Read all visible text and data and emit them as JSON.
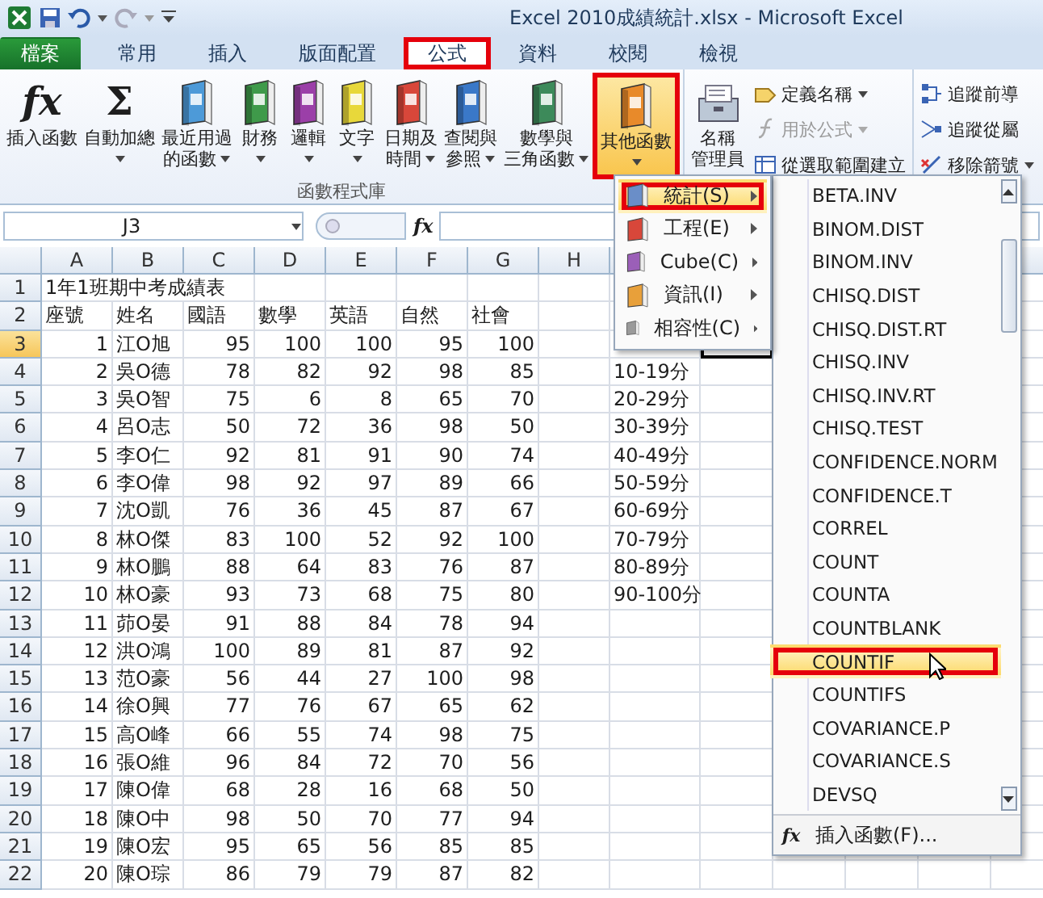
{
  "title_bar": {
    "title": "Excel 2010成績統計.xlsx - Microsoft Excel"
  },
  "ribbon_tabs": [
    {
      "label": "檔案",
      "kind": "file",
      "selected": false,
      "highlighted": false
    },
    {
      "label": "常用",
      "kind": "tab",
      "selected": false,
      "highlighted": false
    },
    {
      "label": "插入",
      "kind": "tab",
      "selected": false,
      "highlighted": false
    },
    {
      "label": "版面配置",
      "kind": "tab",
      "selected": false,
      "highlighted": false
    },
    {
      "label": "公式",
      "kind": "tab",
      "selected": true,
      "highlighted": true
    },
    {
      "label": "資料",
      "kind": "tab",
      "selected": false,
      "highlighted": false
    },
    {
      "label": "校閱",
      "kind": "tab",
      "selected": false,
      "highlighted": false
    },
    {
      "label": "檢視",
      "kind": "tab",
      "selected": false,
      "highlighted": false
    }
  ],
  "function_library": {
    "label": "函數程式庫",
    "buttons": [
      {
        "kind": "glyph",
        "glyph": "fx",
        "lines": [
          "插入函數"
        ],
        "dropdown": false,
        "open": false,
        "highlighted": false
      },
      {
        "kind": "glyph",
        "glyph": "Σ",
        "lines": [
          "自動加總"
        ],
        "dropdown": true,
        "open": false,
        "highlighted": false
      },
      {
        "kind": "book",
        "color": "#4d9ad8",
        "lines": [
          "最近用過",
          "的函數"
        ],
        "dropdown": true,
        "open": false,
        "highlighted": false
      },
      {
        "kind": "book",
        "color": "#3f9a4a",
        "lines": [
          "財務"
        ],
        "dropdown": true,
        "open": false,
        "highlighted": false
      },
      {
        "kind": "book",
        "color": "#9b3fa8",
        "lines": [
          "邏輯"
        ],
        "dropdown": true,
        "open": false,
        "highlighted": false
      },
      {
        "kind": "book",
        "color": "#e8d83a",
        "lines": [
          "文字"
        ],
        "dropdown": true,
        "open": false,
        "highlighted": false
      },
      {
        "kind": "book",
        "color": "#d8473a",
        "lines": [
          "日期及",
          "時間"
        ],
        "dropdown": true,
        "open": false,
        "highlighted": false
      },
      {
        "kind": "book",
        "color": "#3a78c8",
        "lines": [
          "查閱與",
          "參照"
        ],
        "dropdown": true,
        "open": false,
        "highlighted": false
      },
      {
        "kind": "book",
        "color": "#3d8a5a",
        "lines": [
          "數學與",
          "三角函數"
        ],
        "dropdown": true,
        "open": false,
        "highlighted": false
      },
      {
        "kind": "book",
        "color": "#e88a2a",
        "lines": [
          "其他函數"
        ],
        "dropdown": true,
        "open": true,
        "highlighted": true
      }
    ]
  },
  "defined_names": {
    "manager": {
      "lines": [
        "名稱",
        "管理員"
      ]
    },
    "commands": [
      {
        "label": "定義名稱",
        "dropdown": true,
        "disabled": false
      },
      {
        "label": "用於公式",
        "dropdown": true,
        "disabled": true
      },
      {
        "label": "從選取範圍建立",
        "dropdown": false,
        "disabled": false
      }
    ]
  },
  "formula_auditing": {
    "commands": [
      {
        "label": "追蹤前導",
        "dropdown": false
      },
      {
        "label": "追蹤從屬",
        "dropdown": false
      },
      {
        "label": "移除箭號",
        "dropdown": true
      }
    ]
  },
  "formula_bar": {
    "name_box": "J3",
    "fx": "fx"
  },
  "sheet": {
    "columns": [
      "A",
      "B",
      "C",
      "D",
      "E",
      "F",
      "G",
      "H"
    ],
    "rows": [
      {
        "header": "1",
        "kind": "title",
        "title": "1年1班期中考成績表",
        "active": false
      },
      {
        "header": "2",
        "kind": "header",
        "cells": [
          "座號",
          "姓名",
          "國語",
          "數學",
          "英語",
          "自然",
          "社會"
        ],
        "active": false
      },
      {
        "header": "3",
        "kind": "data",
        "cells": [
          "1",
          "江O旭",
          "95",
          "100",
          "100",
          "95",
          "100"
        ],
        "active": true
      },
      {
        "header": "4",
        "kind": "data",
        "cells": [
          "2",
          "吳O德",
          "78",
          "82",
          "92",
          "98",
          "85"
        ],
        "column_i": "10-19分",
        "active": false
      },
      {
        "header": "5",
        "kind": "data",
        "cells": [
          "3",
          "吳O智",
          "75",
          "6",
          "8",
          "65",
          "70"
        ],
        "column_i": "20-29分",
        "active": false
      },
      {
        "header": "6",
        "kind": "data",
        "cells": [
          "4",
          "呂O志",
          "50",
          "72",
          "36",
          "98",
          "50"
        ],
        "column_i": "30-39分",
        "active": false
      },
      {
        "header": "7",
        "kind": "data",
        "cells": [
          "5",
          "李O仁",
          "92",
          "81",
          "91",
          "90",
          "74"
        ],
        "column_i": "40-49分",
        "active": false
      },
      {
        "header": "8",
        "kind": "data",
        "cells": [
          "6",
          "李O偉",
          "98",
          "92",
          "97",
          "89",
          "66"
        ],
        "column_i": "50-59分",
        "active": false
      },
      {
        "header": "9",
        "kind": "data",
        "cells": [
          "7",
          "沈O凱",
          "76",
          "36",
          "45",
          "87",
          "67"
        ],
        "column_i": "60-69分",
        "active": false
      },
      {
        "header": "10",
        "kind": "data",
        "cells": [
          "8",
          "林O傑",
          "83",
          "100",
          "52",
          "92",
          "100"
        ],
        "column_i": "70-79分",
        "active": false
      },
      {
        "header": "11",
        "kind": "data",
        "cells": [
          "9",
          "林O鵬",
          "88",
          "64",
          "83",
          "76",
          "87"
        ],
        "column_i": "80-89分",
        "active": false
      },
      {
        "header": "12",
        "kind": "data",
        "cells": [
          "10",
          "林O豪",
          "93",
          "73",
          "68",
          "75",
          "80"
        ],
        "column_i": "90-100分",
        "active": false
      },
      {
        "header": "13",
        "kind": "data",
        "cells": [
          "11",
          "茆O晏",
          "91",
          "88",
          "84",
          "78",
          "94"
        ],
        "active": false
      },
      {
        "header": "14",
        "kind": "data",
        "cells": [
          "12",
          "洪O鴻",
          "100",
          "89",
          "81",
          "87",
          "92"
        ],
        "active": false
      },
      {
        "header": "15",
        "kind": "data",
        "cells": [
          "13",
          "范O豪",
          "56",
          "44",
          "27",
          "100",
          "98"
        ],
        "active": false
      },
      {
        "header": "16",
        "kind": "data",
        "cells": [
          "14",
          "徐O興",
          "77",
          "76",
          "67",
          "65",
          "62"
        ],
        "active": false
      },
      {
        "header": "17",
        "kind": "data",
        "cells": [
          "15",
          "高O峰",
          "66",
          "55",
          "74",
          "98",
          "75"
        ],
        "active": false
      },
      {
        "header": "18",
        "kind": "data",
        "cells": [
          "16",
          "張O維",
          "96",
          "84",
          "72",
          "70",
          "56"
        ],
        "active": false
      },
      {
        "header": "19",
        "kind": "data",
        "cells": [
          "17",
          "陳O偉",
          "68",
          "28",
          "16",
          "68",
          "50"
        ],
        "active": false
      },
      {
        "header": "20",
        "kind": "data",
        "cells": [
          "18",
          "陳O中",
          "98",
          "50",
          "70",
          "77",
          "94"
        ],
        "active": false
      },
      {
        "header": "21",
        "kind": "data",
        "cells": [
          "19",
          "陳O宏",
          "95",
          "65",
          "56",
          "85",
          "85"
        ],
        "active": false
      },
      {
        "header": "22",
        "kind": "data",
        "cells": [
          "20",
          "陳O琮",
          "86",
          "79",
          "79",
          "87",
          "82"
        ],
        "active": false
      }
    ]
  },
  "category_menu": [
    {
      "label": "統計(S)",
      "color": "#6a8ec8",
      "selected": true,
      "highlighted": true
    },
    {
      "label": "工程(E)",
      "color": "#d8473a",
      "selected": false,
      "highlighted": false
    },
    {
      "label": "Cube(C)",
      "color": "#9b5fb8",
      "selected": false,
      "highlighted": false
    },
    {
      "label": "資訊(I)",
      "color": "#e8a03a",
      "selected": false,
      "highlighted": false
    },
    {
      "label": "相容性(C)",
      "color": "#9a9a9a",
      "selected": false,
      "highlighted": false
    }
  ],
  "function_menu": {
    "items": [
      {
        "label": "BETA.INV",
        "selected": false,
        "highlighted": false
      },
      {
        "label": "BINOM.DIST",
        "selected": false,
        "highlighted": false
      },
      {
        "label": "BINOM.INV",
        "selected": false,
        "highlighted": false
      },
      {
        "label": "CHISQ.DIST",
        "selected": false,
        "highlighted": false
      },
      {
        "label": "CHISQ.DIST.RT",
        "selected": false,
        "highlighted": false
      },
      {
        "label": "CHISQ.INV",
        "selected": false,
        "highlighted": false
      },
      {
        "label": "CHISQ.INV.RT",
        "selected": false,
        "highlighted": false
      },
      {
        "label": "CHISQ.TEST",
        "selected": false,
        "highlighted": false
      },
      {
        "label": "CONFIDENCE.NORM",
        "selected": false,
        "highlighted": false
      },
      {
        "label": "CONFIDENCE.T",
        "selected": false,
        "highlighted": false
      },
      {
        "label": "CORREL",
        "selected": false,
        "highlighted": false
      },
      {
        "label": "COUNT",
        "selected": false,
        "highlighted": false
      },
      {
        "label": "COUNTA",
        "selected": false,
        "highlighted": false
      },
      {
        "label": "COUNTBLANK",
        "selected": false,
        "highlighted": false
      },
      {
        "label": "COUNTIF",
        "selected": true,
        "highlighted": true
      },
      {
        "label": "COUNTIFS",
        "selected": false,
        "highlighted": false
      },
      {
        "label": "COVARIANCE.P",
        "selected": false,
        "highlighted": false
      },
      {
        "label": "COVARIANCE.S",
        "selected": false,
        "highlighted": false
      },
      {
        "label": "DEVSQ",
        "selected": false,
        "highlighted": false
      }
    ],
    "footer": {
      "glyph": "fx",
      "label": "插入函數(F)..."
    }
  }
}
